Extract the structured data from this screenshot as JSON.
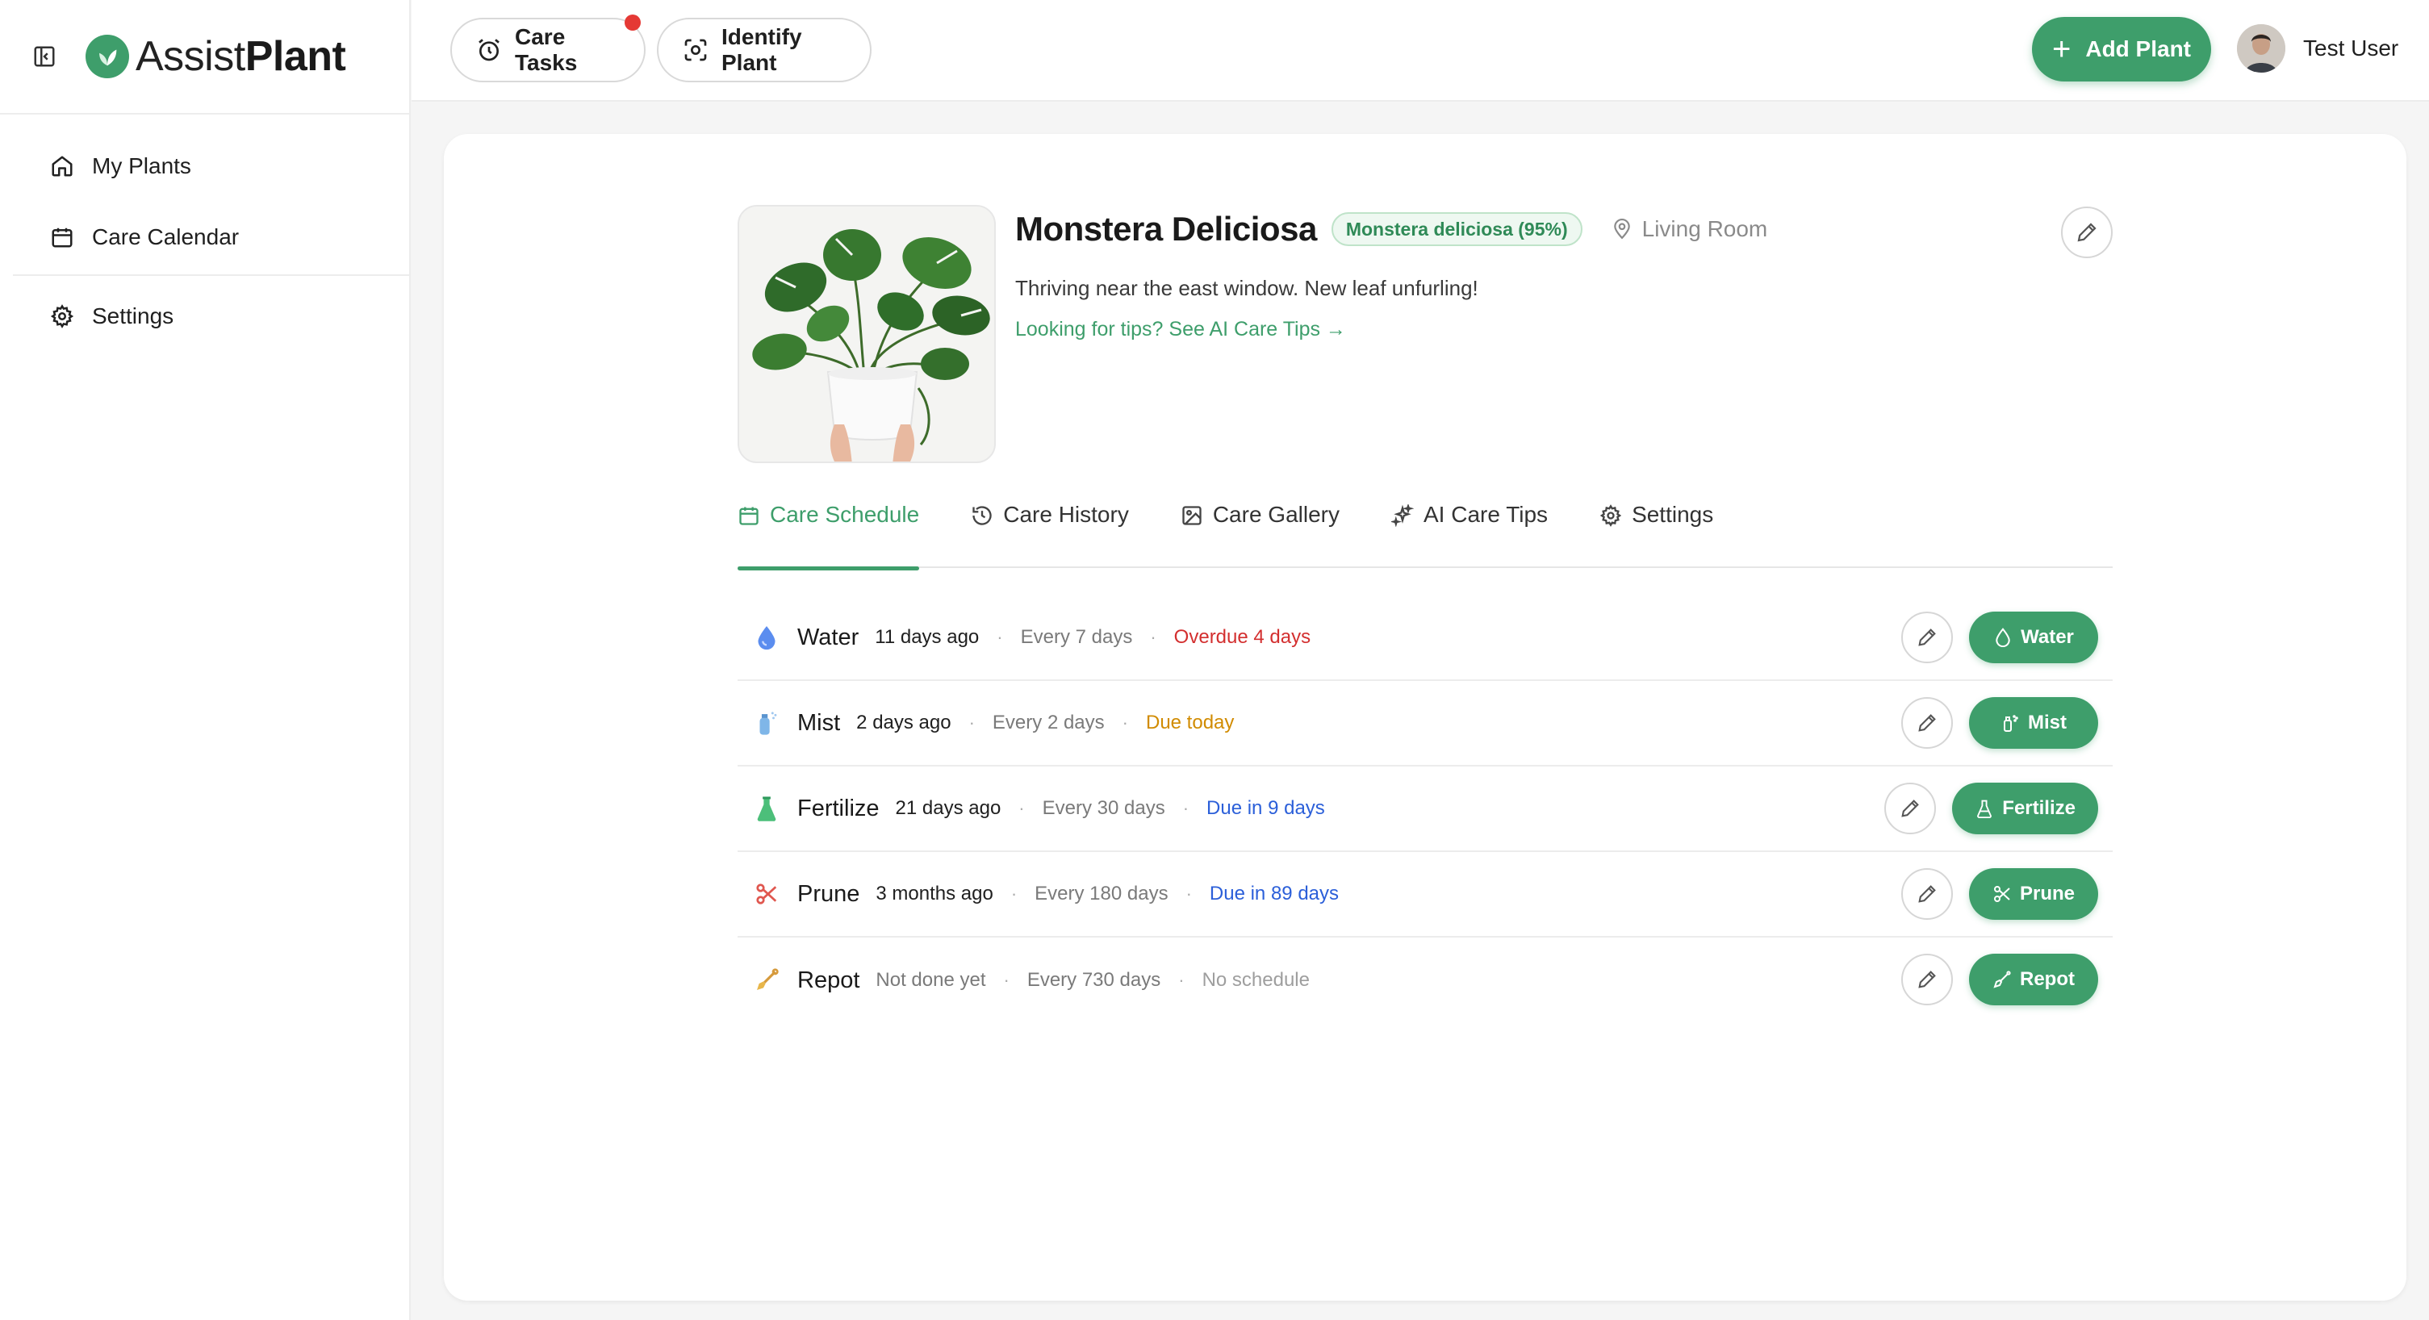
{
  "app": {
    "logo_part1": "Assist",
    "logo_part2": "Plant",
    "brand_color": "#3e9e6b"
  },
  "sidebar": {
    "items": [
      {
        "label": "My Plants",
        "icon": "home-icon"
      },
      {
        "label": "Care Calendar",
        "icon": "calendar-icon"
      },
      {
        "label": "Settings",
        "icon": "gear-icon"
      }
    ]
  },
  "topbar": {
    "care_tasks_label": "Care Tasks",
    "identify_plant_label": "Identify Plant",
    "add_plant_label": "Add Plant",
    "user_name": "Test User"
  },
  "plant": {
    "name": "Monstera Deliciosa",
    "identification": "Monstera deliciosa (95%)",
    "location": "Living Room",
    "description": "Thriving near the east window. New leaf unfurling!",
    "tips_link": "Looking for tips? See AI Care Tips →"
  },
  "tabs": [
    {
      "label": "Care Schedule",
      "icon": "calendar-icon",
      "active": true
    },
    {
      "label": "Care History",
      "icon": "history-icon",
      "active": false
    },
    {
      "label": "Care Gallery",
      "icon": "image-icon",
      "active": false
    },
    {
      "label": "AI Care Tips",
      "icon": "sparkles-icon",
      "active": false
    },
    {
      "label": "Settings",
      "icon": "gear-icon",
      "active": false
    }
  ],
  "schedule": [
    {
      "task": "Water",
      "last": "11 days ago",
      "frequency": "Every 7 days",
      "status": "Overdue 4 days",
      "status_type": "overdue",
      "button": "Water",
      "icon": "water-drop-icon"
    },
    {
      "task": "Mist",
      "last": "2 days ago",
      "frequency": "Every 2 days",
      "status": "Due today",
      "status_type": "today",
      "button": "Mist",
      "icon": "spray-bottle-icon"
    },
    {
      "task": "Fertilize",
      "last": "21 days ago",
      "frequency": "Every 30 days",
      "status": "Due in 9 days",
      "status_type": "future",
      "button": "Fertilize",
      "icon": "flask-icon"
    },
    {
      "task": "Prune",
      "last": "3 months ago",
      "frequency": "Every 180 days",
      "status": "Due in 89 days",
      "status_type": "future",
      "button": "Prune",
      "icon": "scissors-icon"
    },
    {
      "task": "Repot",
      "last": "Not done yet",
      "frequency": "Every 730 days",
      "status": "No schedule",
      "status_type": "none",
      "button": "Repot",
      "icon": "shovel-icon"
    }
  ],
  "colors": {
    "overdue": "#d32f2f",
    "today": "#d18b00",
    "future": "#2b5fd9",
    "none": "#9e9e9e",
    "notification": "#e53935"
  }
}
